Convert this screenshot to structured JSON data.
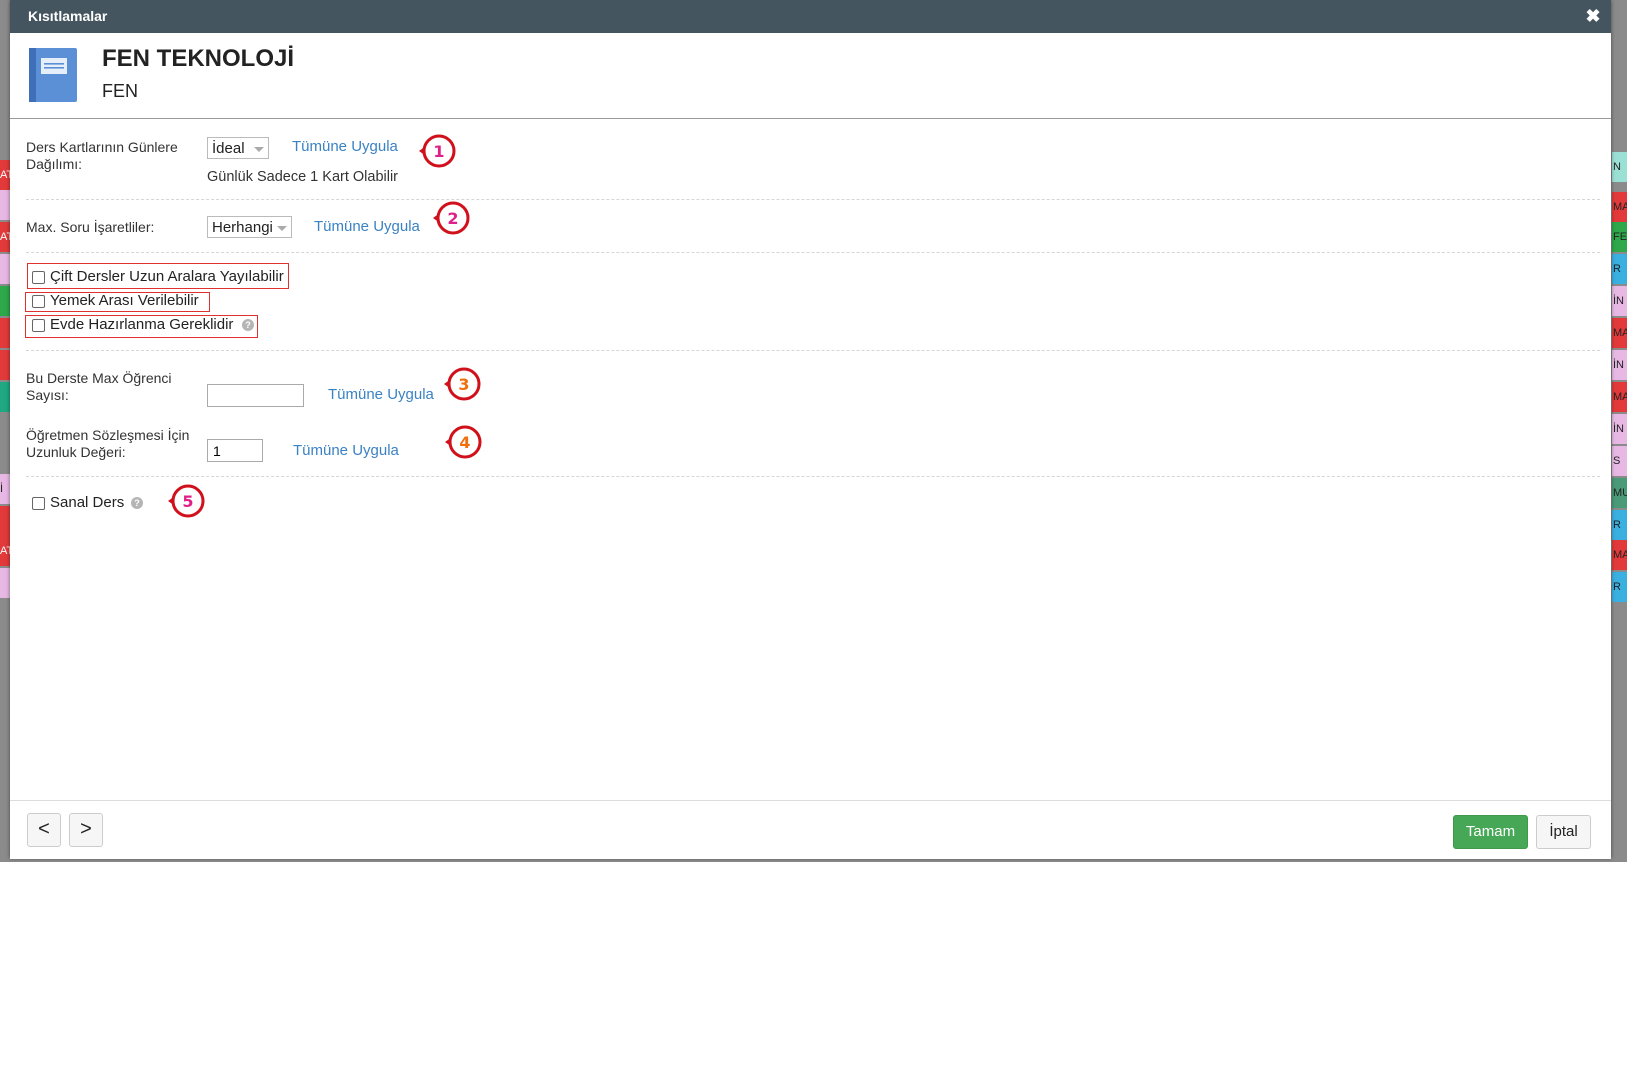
{
  "dialog": {
    "title": "Kısıtlamalar",
    "close_glyph": "✖"
  },
  "header": {
    "course_name": "FEN TEKNOLOJİ",
    "course_code": "FEN"
  },
  "form": {
    "distribution": {
      "label": "Ders Kartlarının Günlere Dağılımı:",
      "selected": "İdeal",
      "apply_all": "Tümüne Uygula",
      "hint": "Günlük Sadece 1 Kart Olabilir"
    },
    "max_question": {
      "label": "Max. Soru İşaretliler:",
      "selected": "Herhangi",
      "apply_all": "Tümüne Uygula"
    },
    "checkboxes": [
      {
        "label": "Çift Dersler Uzun Aralara Yayılabilir",
        "checked": false
      },
      {
        "label": "Yemek Arası Verilebilir",
        "checked": false
      },
      {
        "label": "Evde Hazırlanma Gereklidir",
        "checked": false
      }
    ],
    "max_students": {
      "label": "Bu Derste Max Öğrenci Sayısı:",
      "value": "",
      "apply_all": "Tümüne Uygula"
    },
    "contract_length": {
      "label": "Öğretmen Sözleşmesi İçin Uzunluk Değeri:",
      "value": "1",
      "apply_all": "Tümüne Uygula"
    },
    "virtual_lesson": {
      "label": "Sanal Ders",
      "checked": false
    }
  },
  "annotations": [
    "1",
    "2",
    "3",
    "4",
    "5"
  ],
  "footer": {
    "prev": "<",
    "next": ">",
    "ok": "Tamam",
    "cancel": "İptal"
  },
  "background_strips": {
    "left": [
      "AT",
      "",
      "AT",
      "",
      "",
      "",
      "",
      "",
      "İ",
      "",
      "AT",
      ""
    ],
    "right": [
      "N",
      "MA",
      "FE",
      "R",
      "İN",
      "MA",
      "İN",
      "MA",
      "İN",
      "S",
      "MU",
      "R",
      "MA",
      "R"
    ]
  },
  "colors": {
    "titlebar": "#45555f",
    "link": "#3a82c4",
    "ok_button": "#46a856",
    "highlight_box": "#e03030",
    "annotation_ring": "#d0101a"
  }
}
